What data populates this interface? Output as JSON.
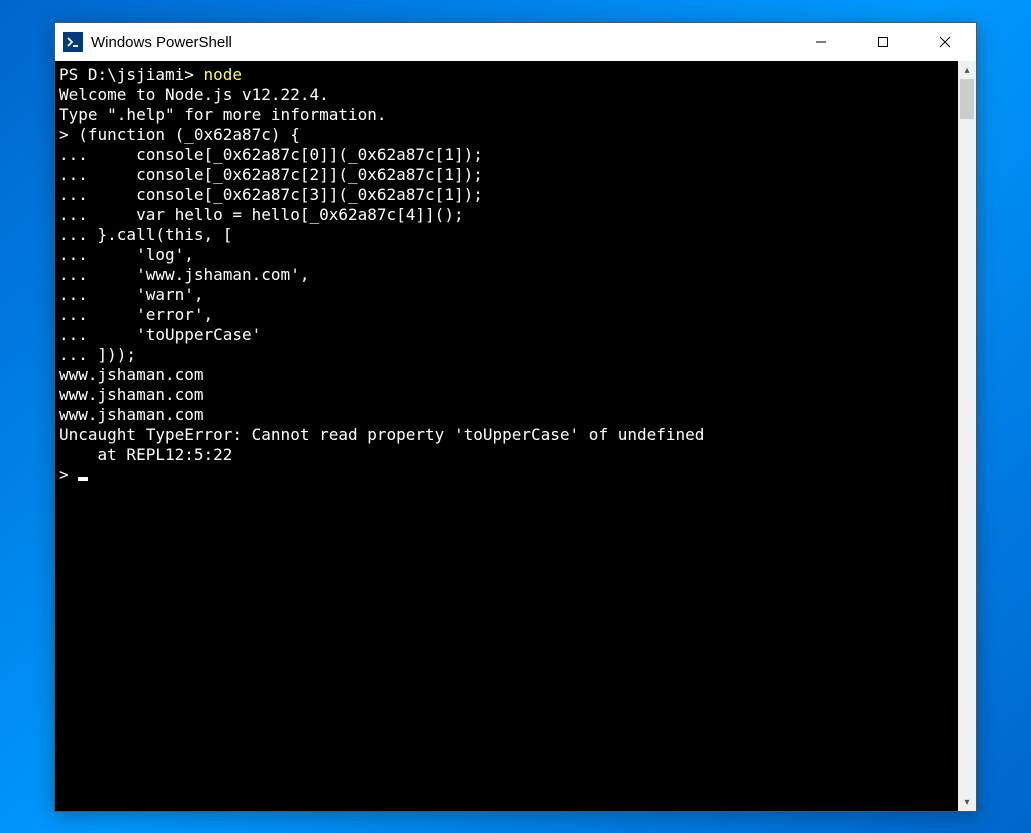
{
  "window": {
    "title": "Windows PowerShell"
  },
  "terminal": {
    "prompt_prefix": "PS D:\\jsjiami> ",
    "command": "node",
    "lines": [
      "Welcome to Node.js v12.22.4.",
      "Type \".help\" for more information.",
      "> (function (_0x62a87c) {",
      "...     console[_0x62a87c[0]](_0x62a87c[1]);",
      "...     console[_0x62a87c[2]](_0x62a87c[1]);",
      "...     console[_0x62a87c[3]](_0x62a87c[1]);",
      "...     var hello = hello[_0x62a87c[4]]();",
      "... }.call(this, [",
      "...     'log',",
      "...     'www.jshaman.com',",
      "...     'warn',",
      "...     'error',",
      "...     'toUpperCase'",
      "... ]));",
      "www.jshaman.com",
      "www.jshaman.com",
      "www.jshaman.com",
      "Uncaught TypeError: Cannot read property 'toUpperCase' of undefined",
      "    at REPL12:5:22",
      "> "
    ]
  }
}
